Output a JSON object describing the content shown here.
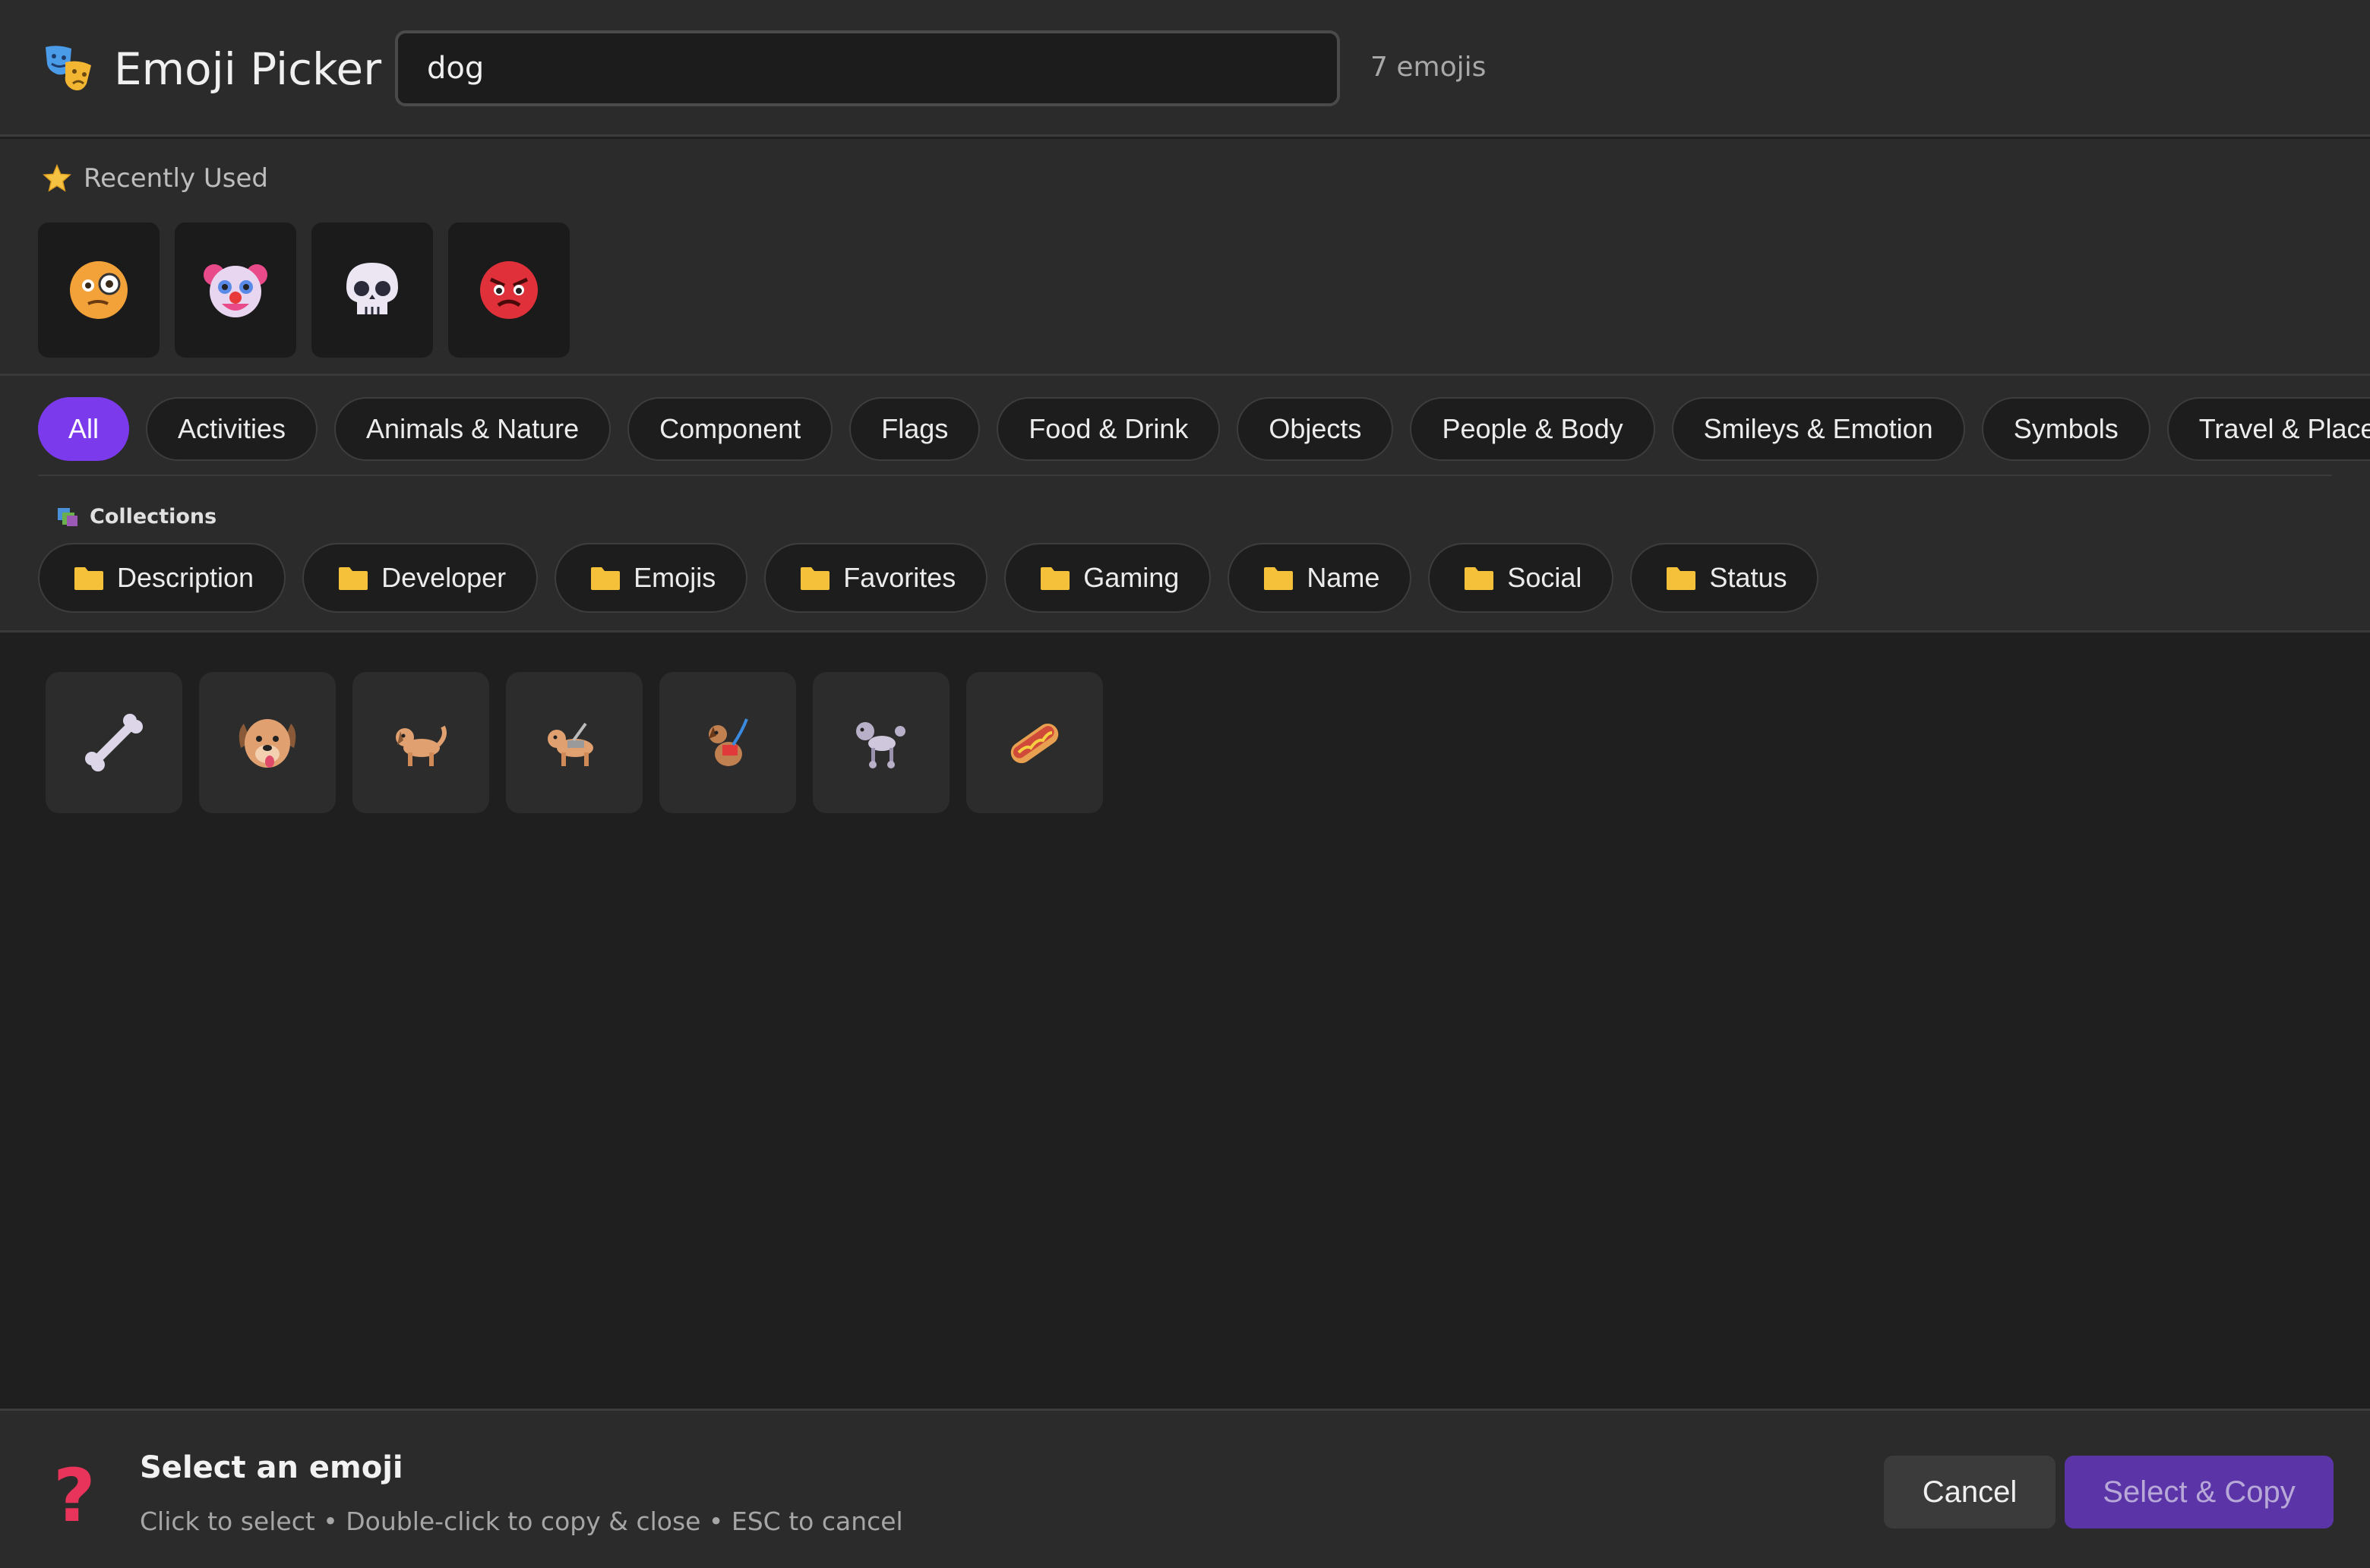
{
  "header": {
    "app_icon": "performing-arts-icon",
    "title": "Emoji Picker",
    "search_value": "dog",
    "count": "7 emojis"
  },
  "recent": {
    "label": "Recently Used",
    "icon": "star-icon",
    "items": [
      "face-with-monocle",
      "clown-face",
      "skull",
      "angry-face"
    ]
  },
  "categories": {
    "items": [
      "All",
      "Activities",
      "Animals & Nature",
      "Component",
      "Flags",
      "Food & Drink",
      "Objects",
      "People & Body",
      "Smileys & Emotion",
      "Symbols",
      "Travel & Places"
    ],
    "active": "All"
  },
  "collections": {
    "label": "Collections",
    "items": [
      "Description",
      "Developer",
      "Emojis",
      "Favorites",
      "Gaming",
      "Name",
      "Social",
      "Status"
    ]
  },
  "results": [
    "bone",
    "dog-face",
    "dog",
    "guide-dog",
    "service-dog",
    "poodle",
    "hot-dog"
  ],
  "footer": {
    "icon": "question-mark-icon",
    "qmark": "?",
    "title": "Select an emoji",
    "hint": "Click to select • Double-click to copy & close • ESC to cancel",
    "cancel_label": "Cancel",
    "copy_label": "Select & Copy"
  },
  "colors": {
    "accent": "#7c3aed",
    "copy_button": "#5b35a8",
    "background": "#1f1f1f",
    "panel": "#2b2b2b"
  }
}
